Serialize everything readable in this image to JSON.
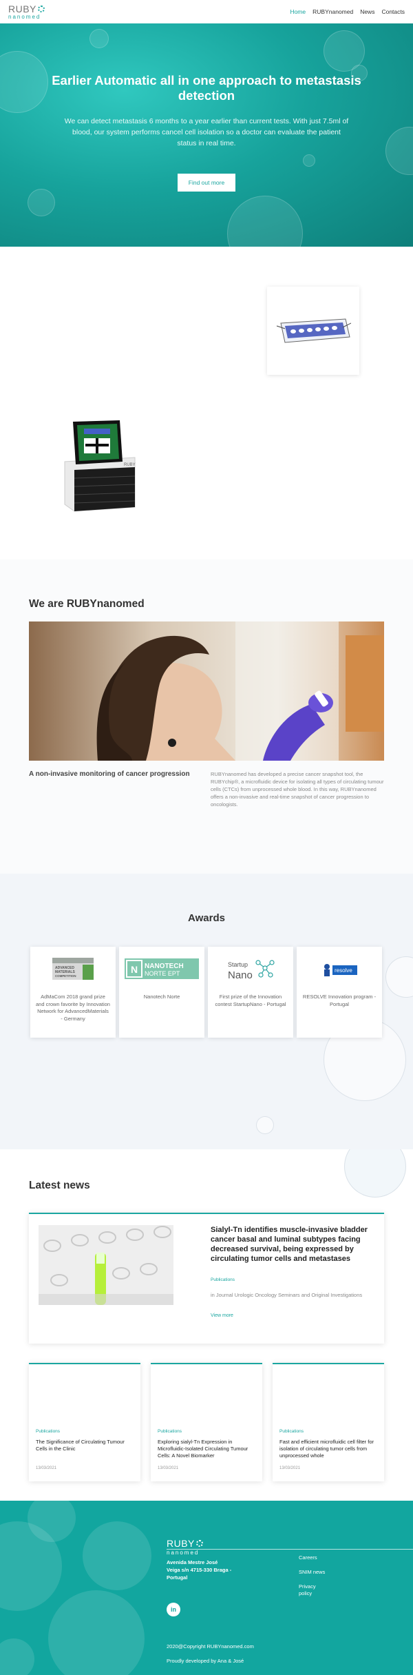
{
  "header": {
    "logo_top": "RUBY",
    "logo_bottom": "nanomed",
    "nav": [
      {
        "label": "Home"
      },
      {
        "label": "RUBYnanomed"
      },
      {
        "label": "News"
      },
      {
        "label": "Contacts"
      }
    ],
    "accent_color": "#1aa6a0"
  },
  "hero": {
    "title": "Earlier Automatic all in one approach to metastasis detection",
    "text": "We can detect metastasis 6 months to a year earlier than current tests. With just 7.5ml of blood, our system performs cancel cell isolation so a doctor can evaluate the patient status in real time.",
    "button": "Find out more"
  },
  "about": {
    "title": "We are RUBYnanomed",
    "subtitle": "A non-invasive monitoring of cancer progression",
    "text": "RUBYnanomed has developed a precise cancer snapshot tool, the RUBYchip®, a microfluidic device for isolating all types of circulating tumour cells (CTCs) from unprocessed whole blood. In this way, RUBYnanomed offers a non-invasive and real-time snapshot of cancer progression to oncologists."
  },
  "awards": {
    "title": "Awards",
    "items": [
      {
        "logo_text": "ADVANCED MATERIALS COMPETITION",
        "text": "AdMaCom 2018 grand prize and crown favorite by Innovation Network for AdvancedMaterials - Germany"
      },
      {
        "logo_text": "NANOTECH NORTE EPT",
        "text": "Nanotech Norte"
      },
      {
        "logo_text": "Startup Nano",
        "text": "First prize of the Innovation contest StartupNano - Portugal"
      },
      {
        "logo_text": "resolve",
        "text": "RESOLVE Innovation program - Portugal"
      }
    ]
  },
  "news": {
    "title": "Latest news",
    "feature": {
      "title": "Sialyl-Tn identifies muscle-invasive bladder cancer basal and luminal subtypes facing decreased survival, being expressed by circulating tumor cells and metastases",
      "tag": "Publications",
      "desc": "in Journal Urologic Oncology Seminars and Original Investigations",
      "link": "View more"
    },
    "cards": [
      {
        "tag": "Publications",
        "title": "The Significance of Circulating Tumour Cells in the Clinic",
        "date": "13/03/2021"
      },
      {
        "tag": "Publications",
        "title": "Exploring sialyl-Tn Expression in Microfluidic-Isolated Circulating Tumour Cells: A Novel Biomarker",
        "date": "13/03/2021"
      },
      {
        "tag": "Publications",
        "title": "Fast and efficient microfluidic cell filter for isolation of circulating tumor cells from unprocessed whole",
        "date": "13/03/2021"
      }
    ]
  },
  "footer": {
    "logo_top": "RUBY",
    "logo_bottom": "nanomed",
    "address": "Avenida Mestre José Veiga s/n 4715-330 Braga - Portugal",
    "links": [
      "Careers",
      "SNIM news",
      "Privacy policy"
    ],
    "linkedin": "in",
    "copyright": "2020@Copyright RUBYnanomed.com",
    "developed": "Proudly developed by Ana & José",
    "background": "#12a69f"
  }
}
